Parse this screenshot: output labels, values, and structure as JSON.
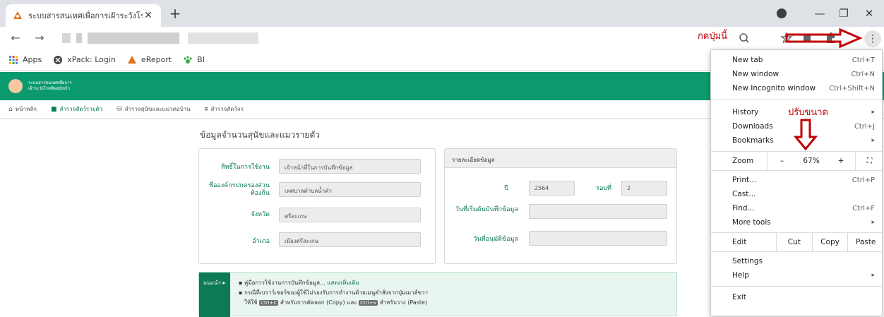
{
  "browser": {
    "tab_title": "ระบบสารสนเทศเพื่อการเฝ้าระวังโรคพิษ",
    "tab_close": "✕",
    "new_tab": "+",
    "window_controls": {
      "profile": "●",
      "minimize": "—",
      "restore": "❐",
      "close": "✕"
    },
    "nav": {
      "back": "←",
      "forward": "→"
    },
    "bookmarks": [
      {
        "label": "Apps",
        "icon": "apps-grid-icon"
      },
      {
        "label": "xPack: Login",
        "icon": "xpack-icon"
      },
      {
        "label": "eReport",
        "icon": "ereport-icon"
      },
      {
        "label": "BI",
        "icon": "bi-icon"
      }
    ]
  },
  "annotations": {
    "press_here": "กดปุ่มนี้",
    "adjust_size": "ปรับขนาด",
    "color": "#c00000"
  },
  "site": {
    "name_line1": "ระบบสารสนเทศเพื่อการ",
    "name_line2": "เฝ้าระวังโรคพิษสุนัขบ้า",
    "nav": [
      {
        "label": "หน้าหลัก",
        "icon": "home-icon"
      },
      {
        "label": "สำรวจสัตว์รายตัว",
        "icon": "list-icon"
      },
      {
        "label": "สำรวจสุนัขและแมวต่อบ้าน",
        "icon": "house-icon"
      },
      {
        "label": "สำรวจสัตว์จร",
        "icon": "paw-icon"
      }
    ],
    "page_title": "ข้อมูลจำนวนสุนัขและแมวรายตัว",
    "user_panel": {
      "fields": [
        {
          "label": "สิทธิ์ในการใช้งาน",
          "value": "เจ้าหน้าที่ในการบันทึกข้อมูล"
        },
        {
          "label": "ชื่อองค์กรปกครองส่วนท้องถิ่น",
          "value": "เทศบาลตำบลน้ำคำ"
        },
        {
          "label": "จังหวัด",
          "value": "ศรีสะเกษ"
        },
        {
          "label": "อำเภอ",
          "value": "เมืองศรีสะเกษ"
        }
      ]
    },
    "detail_panel": {
      "title": "รายละเอียดข้อมูล",
      "year_label": "ปี",
      "year_value": "2564",
      "round_label": "รอบที่",
      "round_value": "2",
      "start_label": "วันที่เริ่มต้นบันทึกข้อมูล",
      "start_value": "",
      "approve_label": "วันที่อนุมัติข้อมูล",
      "approve_value": ""
    },
    "note": {
      "tag": "แนะนำ ▸",
      "line1": "▪ คู่มือการใช้งานการบันทึกข้อมูล...",
      "line1_link": "แสดงเพิ่มเติม",
      "line2": "▪ กรณีที่เบราว์เซอร์ของผู้ใช้ไม่รองรับการทำงานด้วยเมนูคำสั่งจากปุ่มเมาส์ขวา",
      "line3_pre": "ให้ใช้",
      "kbd_copy": "Ctrl+C",
      "line3_mid": "สำหรับการคัดลอก (Copy) และ",
      "kbd_paste": "Ctrl+V",
      "line3_post": "สำหรับวาง (Paste)"
    }
  },
  "menu": {
    "new_tab": "New tab",
    "new_tab_sc": "Ctrl+T",
    "new_window": "New window",
    "new_window_sc": "Ctrl+N",
    "incognito": "New Incognito window",
    "incognito_sc": "Ctrl+Shift+N",
    "history": "History",
    "downloads": "Downloads",
    "downloads_sc": "Ctrl+J",
    "bookmarks": "Bookmarks",
    "zoom": "Zoom",
    "zoom_minus": "–",
    "zoom_value": "67%",
    "zoom_plus": "+",
    "fullscreen": "⛶",
    "print": "Print...",
    "print_sc": "Ctrl+P",
    "cast": "Cast...",
    "find": "Find...",
    "find_sc": "Ctrl+F",
    "more_tools": "More tools",
    "edit": "Edit",
    "cut": "Cut",
    "copy": "Copy",
    "paste": "Paste",
    "settings": "Settings",
    "help": "Help",
    "exit": "Exit",
    "submenu_arrow": "▸"
  },
  "colors": {
    "brand_green": "#0b9a6e",
    "accent_green": "#0b7a55",
    "annotation_red": "#c00000"
  }
}
